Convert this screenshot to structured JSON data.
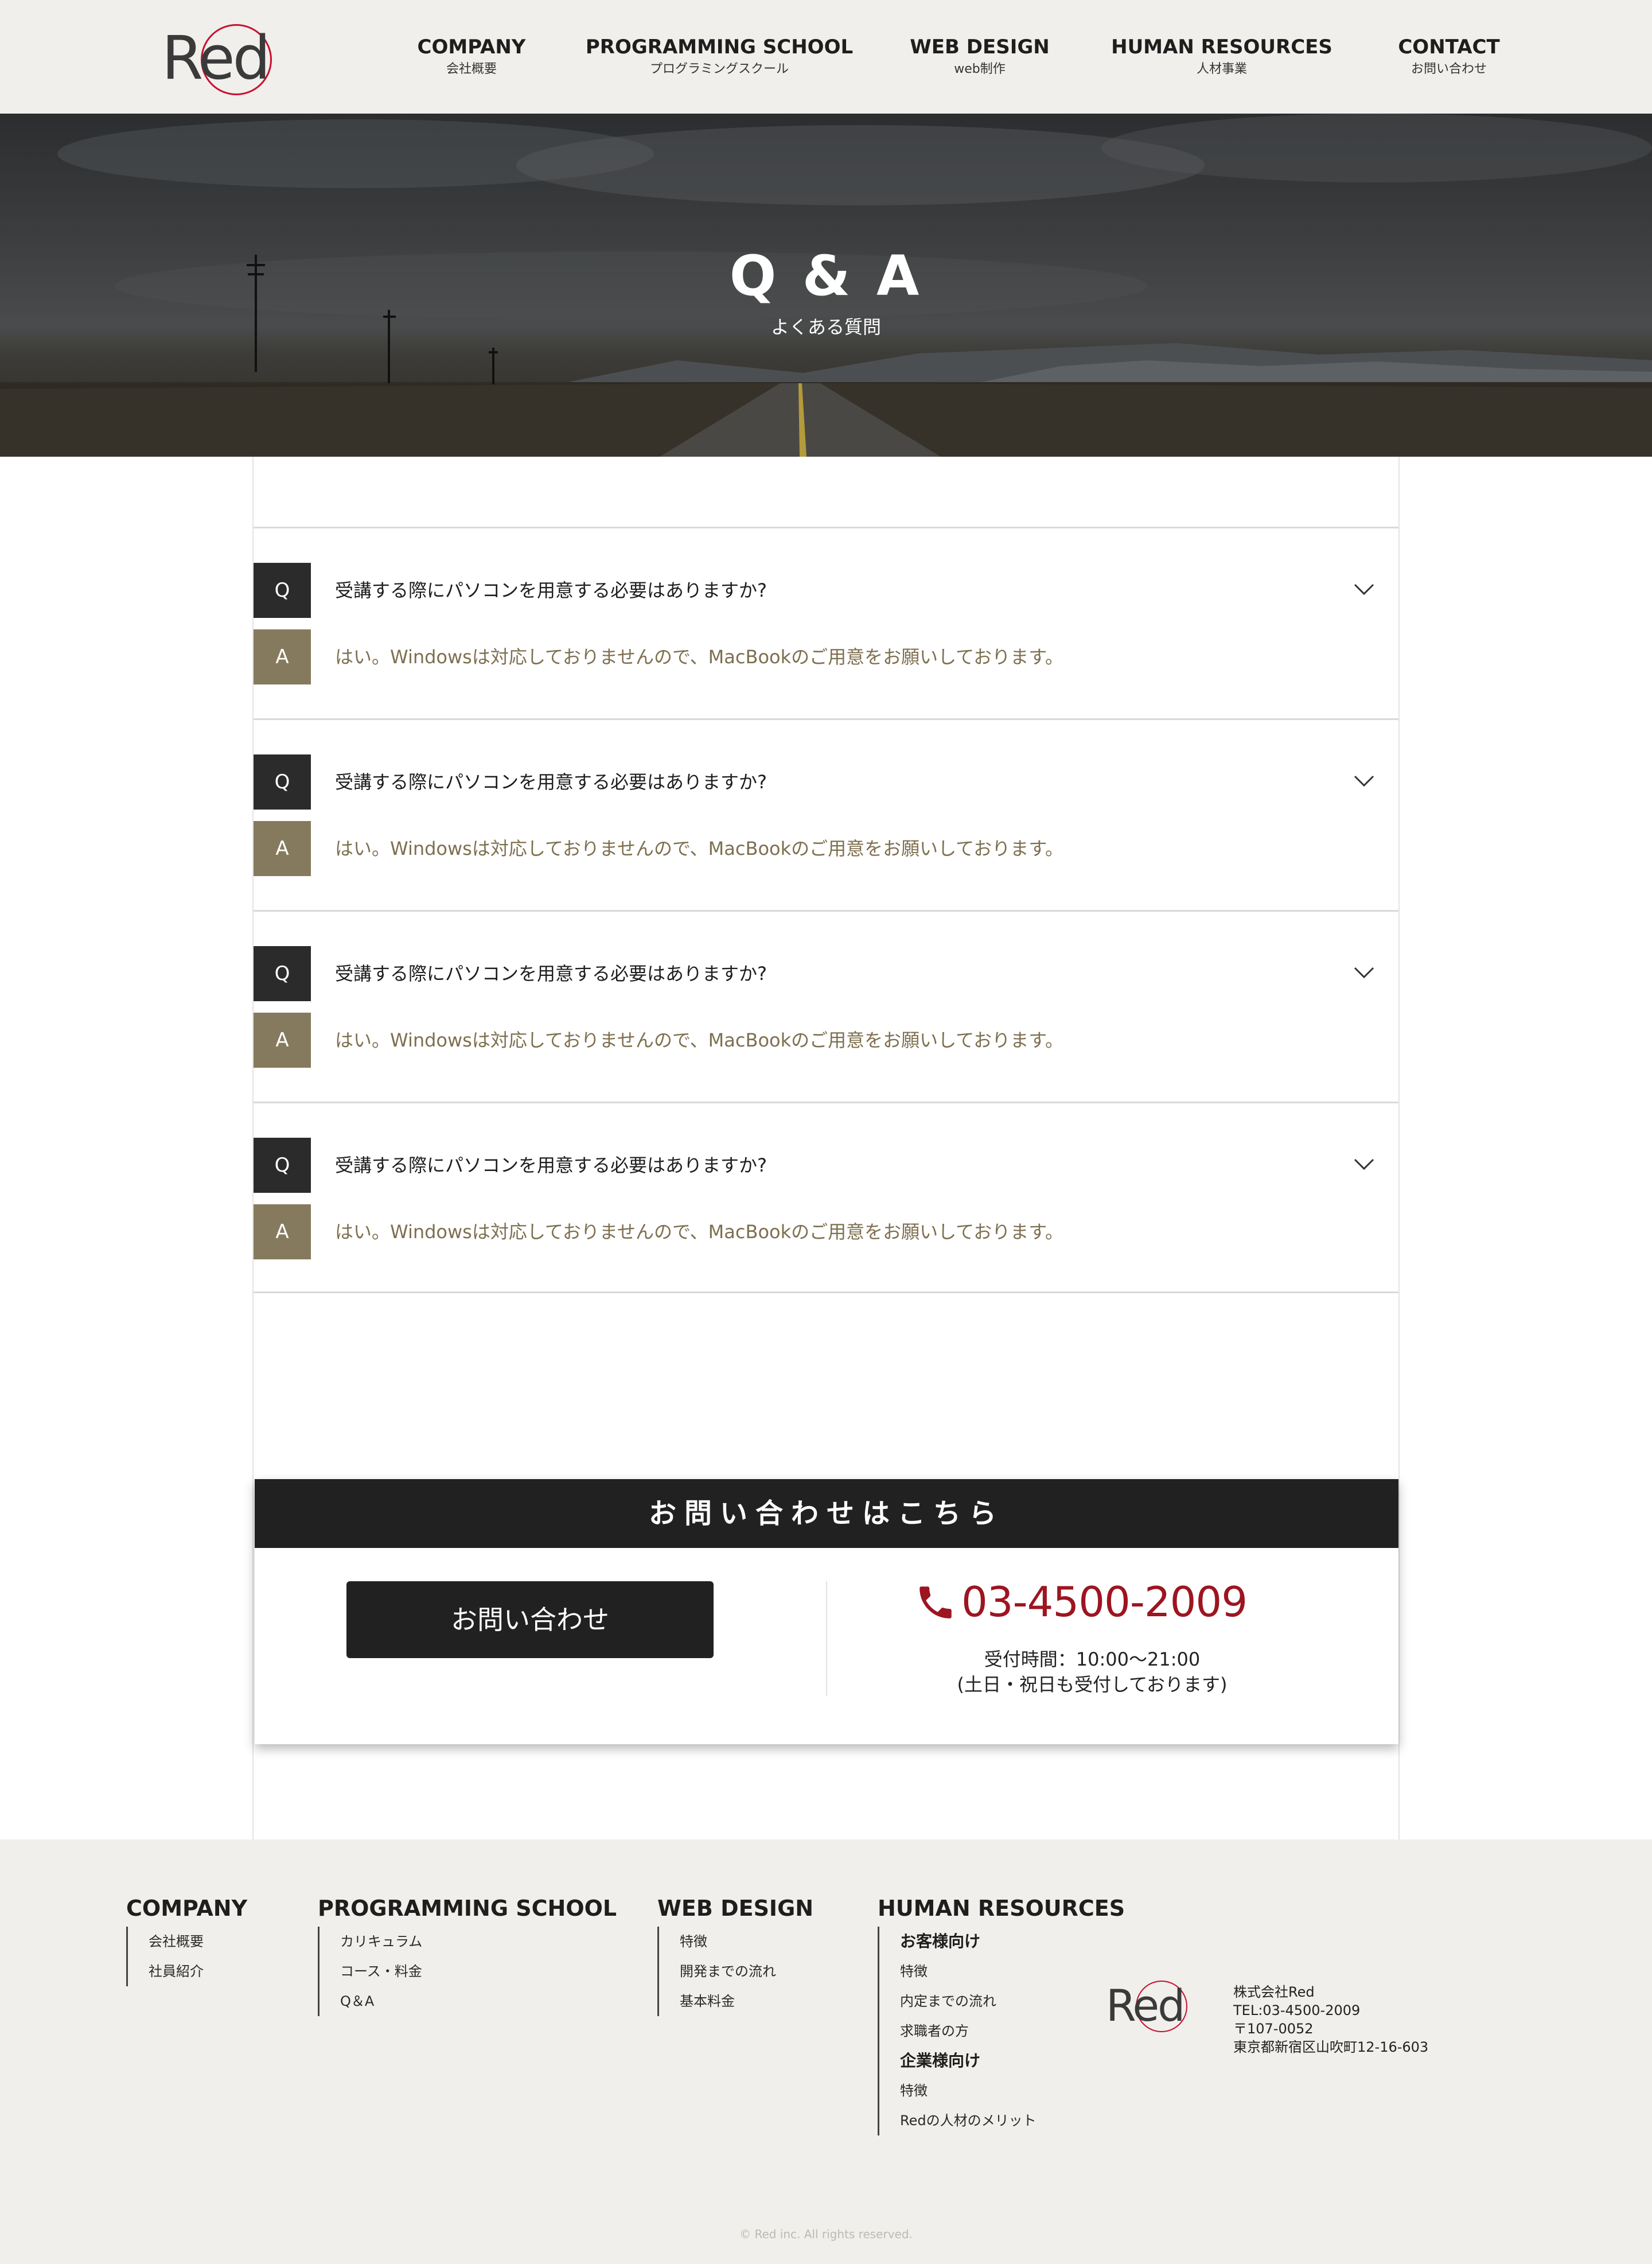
{
  "header": {
    "logo_text": "Red",
    "nav": [
      {
        "en": "COMPANY",
        "ja": "会社概要"
      },
      {
        "en": "PROGRAMMING SCHOOL",
        "ja": "プログラミングスクール"
      },
      {
        "en": "WEB DESIGN",
        "ja": "web制作"
      },
      {
        "en": "HUMAN RESOURCES",
        "ja": "人材事業"
      },
      {
        "en": "CONTACT",
        "ja": "お問い合わせ"
      }
    ]
  },
  "hero": {
    "title": "Q & A",
    "subtitle": "よくある質問"
  },
  "faq": [
    {
      "q_badge": "Q",
      "question": "受講する際にパソコンを用意する必要はありますか?",
      "a_badge": "A",
      "answer": "はい。Windowsは対応しておりませんので、MacBookのご用意をお願いしております。"
    },
    {
      "q_badge": "Q",
      "question": "受講する際にパソコンを用意する必要はありますか?",
      "a_badge": "A",
      "answer": "はい。Windowsは対応しておりませんので、MacBookのご用意をお願いしております。"
    },
    {
      "q_badge": "Q",
      "question": "受講する際にパソコンを用意する必要はありますか?",
      "a_badge": "A",
      "answer": "はい。Windowsは対応しておりませんので、MacBookのご用意をお願いしております。"
    },
    {
      "q_badge": "Q",
      "question": "受講する際にパソコンを用意する必要はありますか?",
      "a_badge": "A",
      "answer": "はい。Windowsは対応しておりませんので、MacBookのご用意をお願いしております。"
    }
  ],
  "contact": {
    "heading": "お問い合わせはこちら",
    "button_label": "お問い合わせ",
    "phone": "03-4500-2009",
    "hours_line1": "受付時間：10:00〜21:00",
    "hours_line2": "(土日・祝日も受付しております)",
    "phone_color": "#9c1520"
  },
  "footer": {
    "columns": [
      {
        "title": "COMPANY",
        "items": [
          "会社概要",
          "社員紹介"
        ]
      },
      {
        "title": "PROGRAMMING SCHOOL",
        "items": [
          "カリキュラム",
          "コース・料金",
          "Q＆A"
        ]
      },
      {
        "title": "WEB DESIGN",
        "items": [
          "特徴",
          "開発までの流れ",
          "基本料金"
        ]
      },
      {
        "title": "HUMAN RESOURCES",
        "group1_title": "お客様向け",
        "group1_items": [
          "特徴",
          "内定までの流れ",
          "求職者の方"
        ],
        "group2_title": "企業様向け",
        "group2_items": [
          "特徴",
          "Redの人材のメリット"
        ]
      }
    ],
    "logo_text": "Red",
    "company": "株式会社Red",
    "tel": "TEL:03-4500-2009",
    "zip": "〒107-0052",
    "address": "東京都新宿区山吹町12-16-603",
    "copyright": "© Red inc. All rights reserved."
  },
  "colors": {
    "brand_red": "#c8102e",
    "answer_badge": "#867a5e",
    "question_badge": "#2b2b2b",
    "page_bg": "#f0efeb"
  }
}
